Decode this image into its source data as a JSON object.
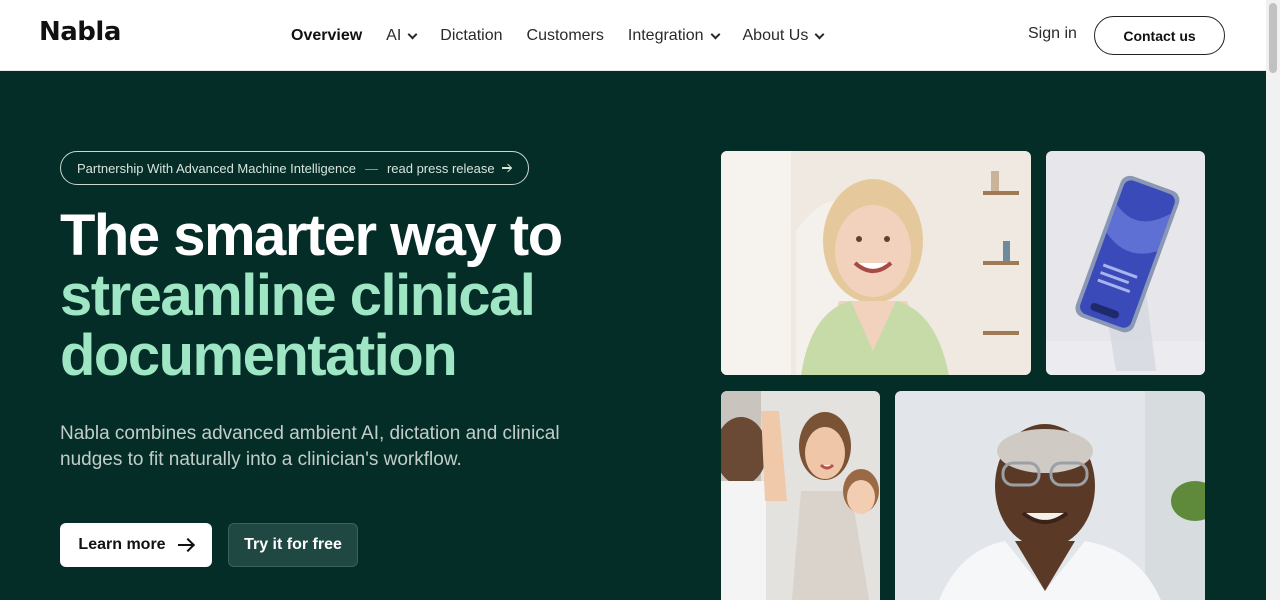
{
  "header": {
    "logo": "Nabla",
    "nav": [
      {
        "label": "Overview",
        "dropdown": false,
        "active": true
      },
      {
        "label": "AI",
        "dropdown": true
      },
      {
        "label": "Dictation",
        "dropdown": false
      },
      {
        "label": "Customers",
        "dropdown": false
      },
      {
        "label": "Integration",
        "dropdown": true
      },
      {
        "label": "About Us",
        "dropdown": true
      }
    ],
    "signin": "Sign in",
    "contact": "Contact us"
  },
  "hero": {
    "announcement": "Partnership With Advanced Machine Intelligence",
    "announcement_sep": "—",
    "announcement_link": "read press release",
    "headline_line1": "The smarter way to",
    "headline_line2": "streamline clinical documentation",
    "subtext": "Nabla combines advanced ambient AI, dictation and clinical nudges to fit naturally into a clinician's workflow.",
    "learn_more": "Learn more",
    "try_free": "Try it for free"
  },
  "colors": {
    "background": "#042d28",
    "accent_text": "#9fe6c5",
    "header_bg": "#ffffff"
  }
}
